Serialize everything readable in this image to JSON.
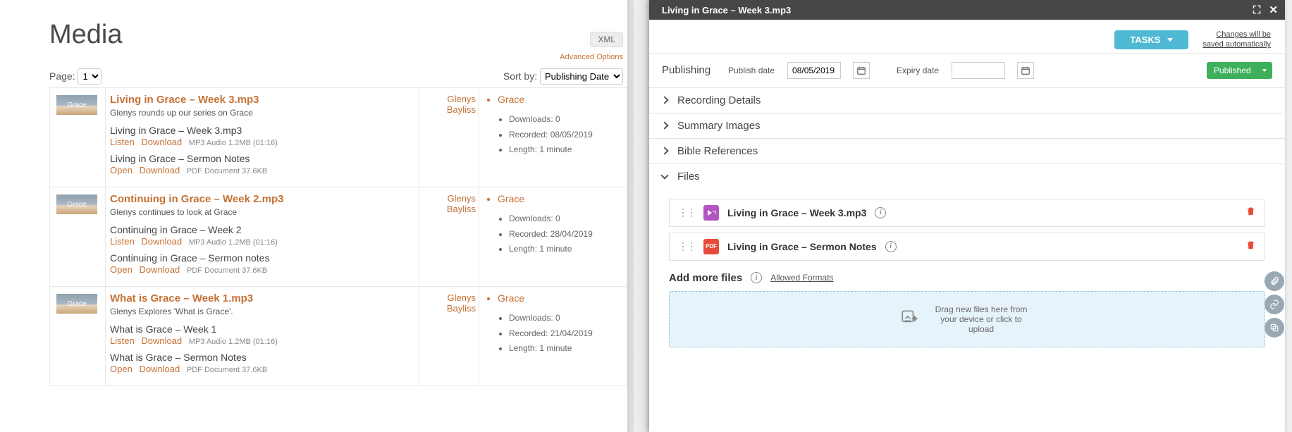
{
  "page_title": "Media",
  "xml_label": "XML",
  "advanced_options_label": "Advanced Options",
  "page_label": "Page:",
  "page_options": [
    "1"
  ],
  "sort_by_label": "Sort by:",
  "sort_options": [
    "Publishing Date"
  ],
  "thumb_label": "Grace",
  "listen_label": "Listen",
  "download_label": "Download",
  "open_label": "Open",
  "media": [
    {
      "title": "Living in Grace – Week 3.mp3",
      "desc": "Glenys rounds up our series on Grace",
      "author": "Glenys Bayliss",
      "category": "Grace",
      "downloads": "Downloads: 0",
      "recorded": "Recorded: 08/05/2019",
      "length": "Length: 1 minute",
      "audio_name": "Living in Grace – Week 3.mp3",
      "audio_meta": "MP3 Audio 1.2MB (01:16)",
      "doc_name": "Living in Grace – Sermon Notes",
      "doc_meta": "PDF Document 37.6KB"
    },
    {
      "title": "Continuing in Grace – Week 2.mp3",
      "desc": "Glenys continues to look at Grace",
      "author": "Glenys Bayliss",
      "category": "Grace",
      "downloads": "Downloads: 0",
      "recorded": "Recorded: 28/04/2019",
      "length": "Length: 1 minute",
      "audio_name": "Continuing in Grace – Week 2",
      "audio_meta": "MP3 Audio 1.2MB (01:16)",
      "doc_name": "Continuing in Grace – Sermon notes",
      "doc_meta": "PDF Document 37.6KB"
    },
    {
      "title": "What is Grace – Week 1.mp3",
      "desc": "Glenys Explores 'What is Grace'.",
      "author": "Glenys Bayliss",
      "category": "Grace",
      "downloads": "Downloads: 0",
      "recorded": "Recorded: 21/04/2019",
      "length": "Length: 1 minute",
      "audio_name": "What is Grace – Week 1",
      "audio_meta": "MP3 Audio 1.2MB (01:16)",
      "doc_name": "What is Grace – Sermon Notes",
      "doc_meta": "PDF Document 37.6KB"
    }
  ],
  "panel": {
    "title": "Living in Grace – Week 3.mp3",
    "tasks_label": "TASKS",
    "auto_save": "Changes will be\nsaved automatically",
    "publishing": {
      "label": "Publishing",
      "publish_date_label": "Publish date",
      "publish_date": "08/05/2019",
      "expiry_date_label": "Expiry date",
      "expiry_date": "",
      "status": "Published"
    },
    "sections": {
      "recording": "Recording Details",
      "summary": "Summary Images",
      "bible": "Bible References",
      "files": "Files"
    },
    "files": [
      {
        "name": "Living in Grace – Week 3.mp3",
        "type": "audio"
      },
      {
        "name": "Living in Grace – Sermon Notes",
        "type": "pdf"
      }
    ],
    "add_more_label": "Add more files",
    "allowed_formats_label": "Allowed Formats",
    "dropzone_text": "Drag new files here from your device or click to upload"
  }
}
